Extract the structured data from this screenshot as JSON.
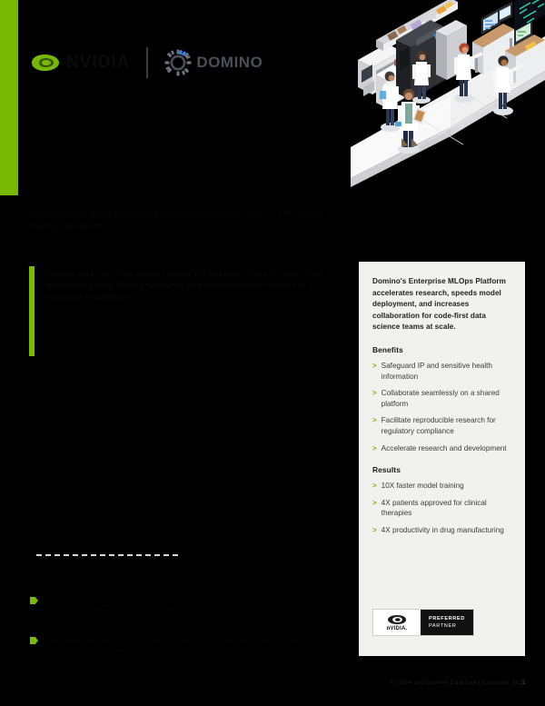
{
  "document": {
    "accent_green": "#76b900",
    "panel_bg": "#f1f1ef",
    "page_bg": "#000000"
  },
  "header": {
    "nvidia_wordmark": "NVIDIA",
    "nvidia_eye_icon": "nvidia-eye-icon",
    "divider": "vertical-divider",
    "domino_mark_icon": "domino-gear-icon",
    "domino_wordmark": "DOMINO"
  },
  "illustration": {
    "name": "isometric-laboratory-illustration",
    "alt": "Isometric illustration of a pharmaceutical research laboratory with scientists in white lab coats, lab instruments, refrigeration units and computer workstations with data dashboards"
  },
  "body": {
    "headline": "Accelerating drug discovery and development with an enterprise MLOps platform",
    "pullquote": "Domino gives our data science teams the freedom to use the tools they want while giving IT the governance and reproducibility required in a regulated environment.",
    "pullquote_attrib": "",
    "paragraphs": [
      "Life sciences organizations are under increasing pressure to bring therapies to market faster while controlling cost and meeting strict regulatory requirements for reproducibility and auditability.",
      "Data science teams often work in siloed environments with inconsistent tooling, making it difficult to reproduce results, share work across groups, or move models into production reliably.",
      "By standardizing on a single enterprise MLOps platform running on NVIDIA accelerated computing, research teams scale experimentation without waiting on infrastructure provisioning.",
      "Centralized environment management, versioned datasets and automatic experiment tracking create a complete audit trail from raw data through to the deployed model.",
      "The result is faster model training, more reproducible science, and measurable improvements in the number of therapies advanced through clinical pipelines."
    ],
    "subhead_rule": "dashed-divider",
    "outcomes": [
      "Researchers self-serve compute on demand, reducing model training time and eliminating infrastructure bottlenecks across distributed teams.",
      "Governance, reproducibility and collaboration are built in, supporting regulatory submissions and cross-functional review."
    ]
  },
  "footer": {
    "text": "NVIDIA and Domino Data Lab | Customer Story",
    "page_number": "1"
  },
  "panel": {
    "intro": "Domino's Enterprise MLOps Platform accelerates research, speeds model deployment, and increases collaboration for code-first data science teams at scale.",
    "benefits_heading": "Benefits",
    "benefits": [
      "Safeguard IP and sensitive health information",
      "Collaborate seamlessly on a shared platform",
      "Facilitate reproducible research for regulatory compliance",
      "Accelerate research and development"
    ],
    "results_heading": "Results",
    "results": [
      "10X faster model training",
      "4X patients approved for clinical therapies",
      "4X productivity in drug manufacturing"
    ],
    "bullet_icon": "chevron-right-icon",
    "badge": {
      "eye_icon": "nvidia-eye-icon",
      "nvidia_label": "nVIDIA.",
      "line1": "PREFERRED",
      "line2": "PARTNER"
    }
  }
}
